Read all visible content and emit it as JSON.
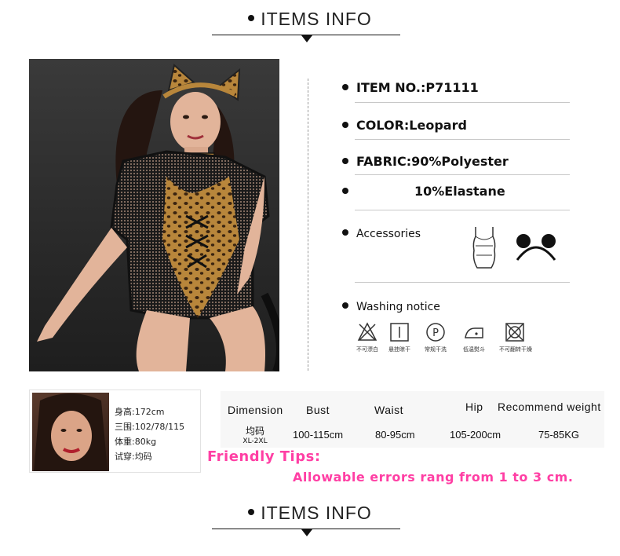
{
  "header_top": {
    "title": "ITEMS INFO"
  },
  "specs": {
    "item_no": "ITEM NO.:P71111",
    "color": "COLOR:Leopard",
    "fabric": "FABRIC:90%Polyester",
    "fabric2": "10%Elastane",
    "accessories": "Accessories",
    "washing": "Washing notice"
  },
  "washing_icons": [
    {
      "icon": "no-bleach-icon",
      "label": "不可漂白"
    },
    {
      "icon": "hang-dry-icon",
      "label": "悬挂晾干"
    },
    {
      "icon": "dry-clean-icon",
      "label": "常规干洗"
    },
    {
      "icon": "low-iron-icon",
      "label": "低温熨斗"
    },
    {
      "icon": "no-tumble-dry-icon",
      "label": "不可翻转干燥"
    }
  ],
  "model": {
    "height": "身高:172cm",
    "measurements": "三围:102/78/115",
    "weight": "体重:80kg",
    "tried": "试穿:均码"
  },
  "dimension": {
    "headers": [
      "Dimension",
      "Bust",
      "Waist",
      "Hip",
      "Recommend weight"
    ],
    "size_cn": "均码",
    "size_range": "XL-2XL",
    "values": [
      "100-115cm",
      "80-95cm",
      "105-200cm",
      "75-85KG"
    ]
  },
  "tips": {
    "title": "Friendly Tips:",
    "body": "Allowable errors rang from 1 to 3 cm."
  },
  "header_bottom": {
    "title": "ITEMS INFO"
  },
  "colors": {
    "accent_pink": "#ff3fa4",
    "leopard": "#b8863b"
  }
}
